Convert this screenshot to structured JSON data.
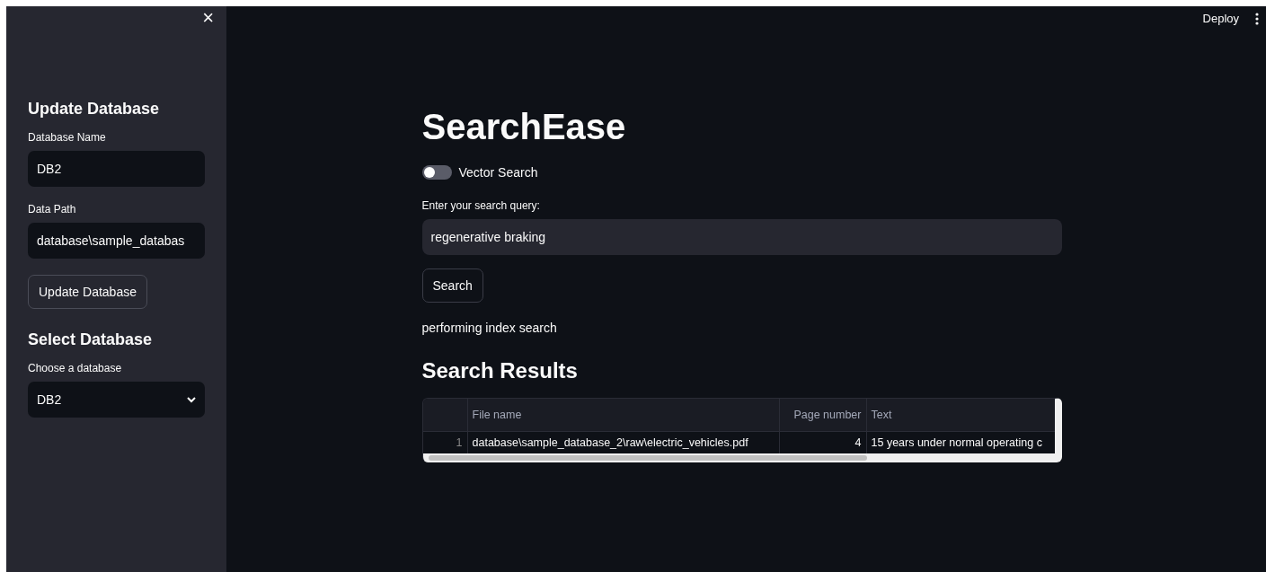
{
  "sidebar": {
    "close": "×",
    "sections": [
      {
        "heading": "Update Database",
        "controls": [
          {
            "kind": "text",
            "label": "Database Name",
            "value": "DB2"
          },
          {
            "kind": "text",
            "label": "Data Path",
            "value": "database\\sample_databas"
          },
          {
            "kind": "button",
            "label": "Update Database"
          }
        ]
      },
      {
        "heading": "Select Database",
        "controls": [
          {
            "kind": "select",
            "label": "Choose a database",
            "value": "DB2"
          }
        ]
      }
    ]
  },
  "header": {
    "deploy": "Deploy"
  },
  "main": {
    "title": "SearchEase",
    "toggle": {
      "label": "Vector Search",
      "on": false
    },
    "query": {
      "label": "Enter your search query:",
      "value": "regenerative braking"
    },
    "button": "Search",
    "status": "performing index search",
    "results_heading": "Search Results",
    "table": {
      "columns": [
        "File name",
        "Page number",
        "Text"
      ],
      "rows": [
        {
          "index": "1",
          "cells": [
            "database\\sample_database_2\\raw\\electric_vehicles.pdf",
            "4",
            "15 years under normal operating c"
          ]
        }
      ]
    }
  }
}
